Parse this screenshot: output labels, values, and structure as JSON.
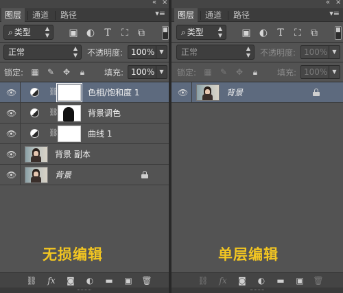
{
  "panels": [
    {
      "tabs": [
        "图层",
        "通道",
        "路径"
      ],
      "filter": {
        "kind_label": "类型"
      },
      "blend_mode": "正常",
      "opacity_label": "不透明度:",
      "opacity_value": "100%",
      "lock_label": "锁定:",
      "fill_label": "填充:",
      "fill_value": "100%",
      "layers": [
        {
          "name": "色相/饱和度 1",
          "kind": "adjustment",
          "selected": true,
          "locked": false
        },
        {
          "name": "背景调色",
          "kind": "adjustment",
          "selected": false,
          "locked": false
        },
        {
          "name": "曲线 1",
          "kind": "adjustment",
          "selected": false,
          "locked": false
        },
        {
          "name": "背景 副本",
          "kind": "pixel",
          "selected": false,
          "locked": false
        },
        {
          "name": "背景",
          "kind": "pixel",
          "selected": false,
          "locked": true
        }
      ],
      "caption": "无损编辑"
    },
    {
      "tabs": [
        "图层",
        "通道",
        "路径"
      ],
      "filter": {
        "kind_label": "类型"
      },
      "blend_mode": "正常",
      "opacity_label": "不透明度:",
      "opacity_value": "100%",
      "lock_label": "锁定:",
      "fill_label": "填充:",
      "fill_value": "100%",
      "layers": [
        {
          "name": "背景",
          "kind": "pixel",
          "selected": true,
          "locked": true
        }
      ],
      "caption": "单层编辑"
    }
  ],
  "icons": {
    "collapse": "double-chevron-left",
    "panel_menu": "panel-menu",
    "visibility": "eye",
    "link": "chain-link",
    "lock": "padlock"
  },
  "colors": {
    "panel_bg": "#535353",
    "selected_row": "#5d6a7e",
    "caption": "#f3c621"
  }
}
